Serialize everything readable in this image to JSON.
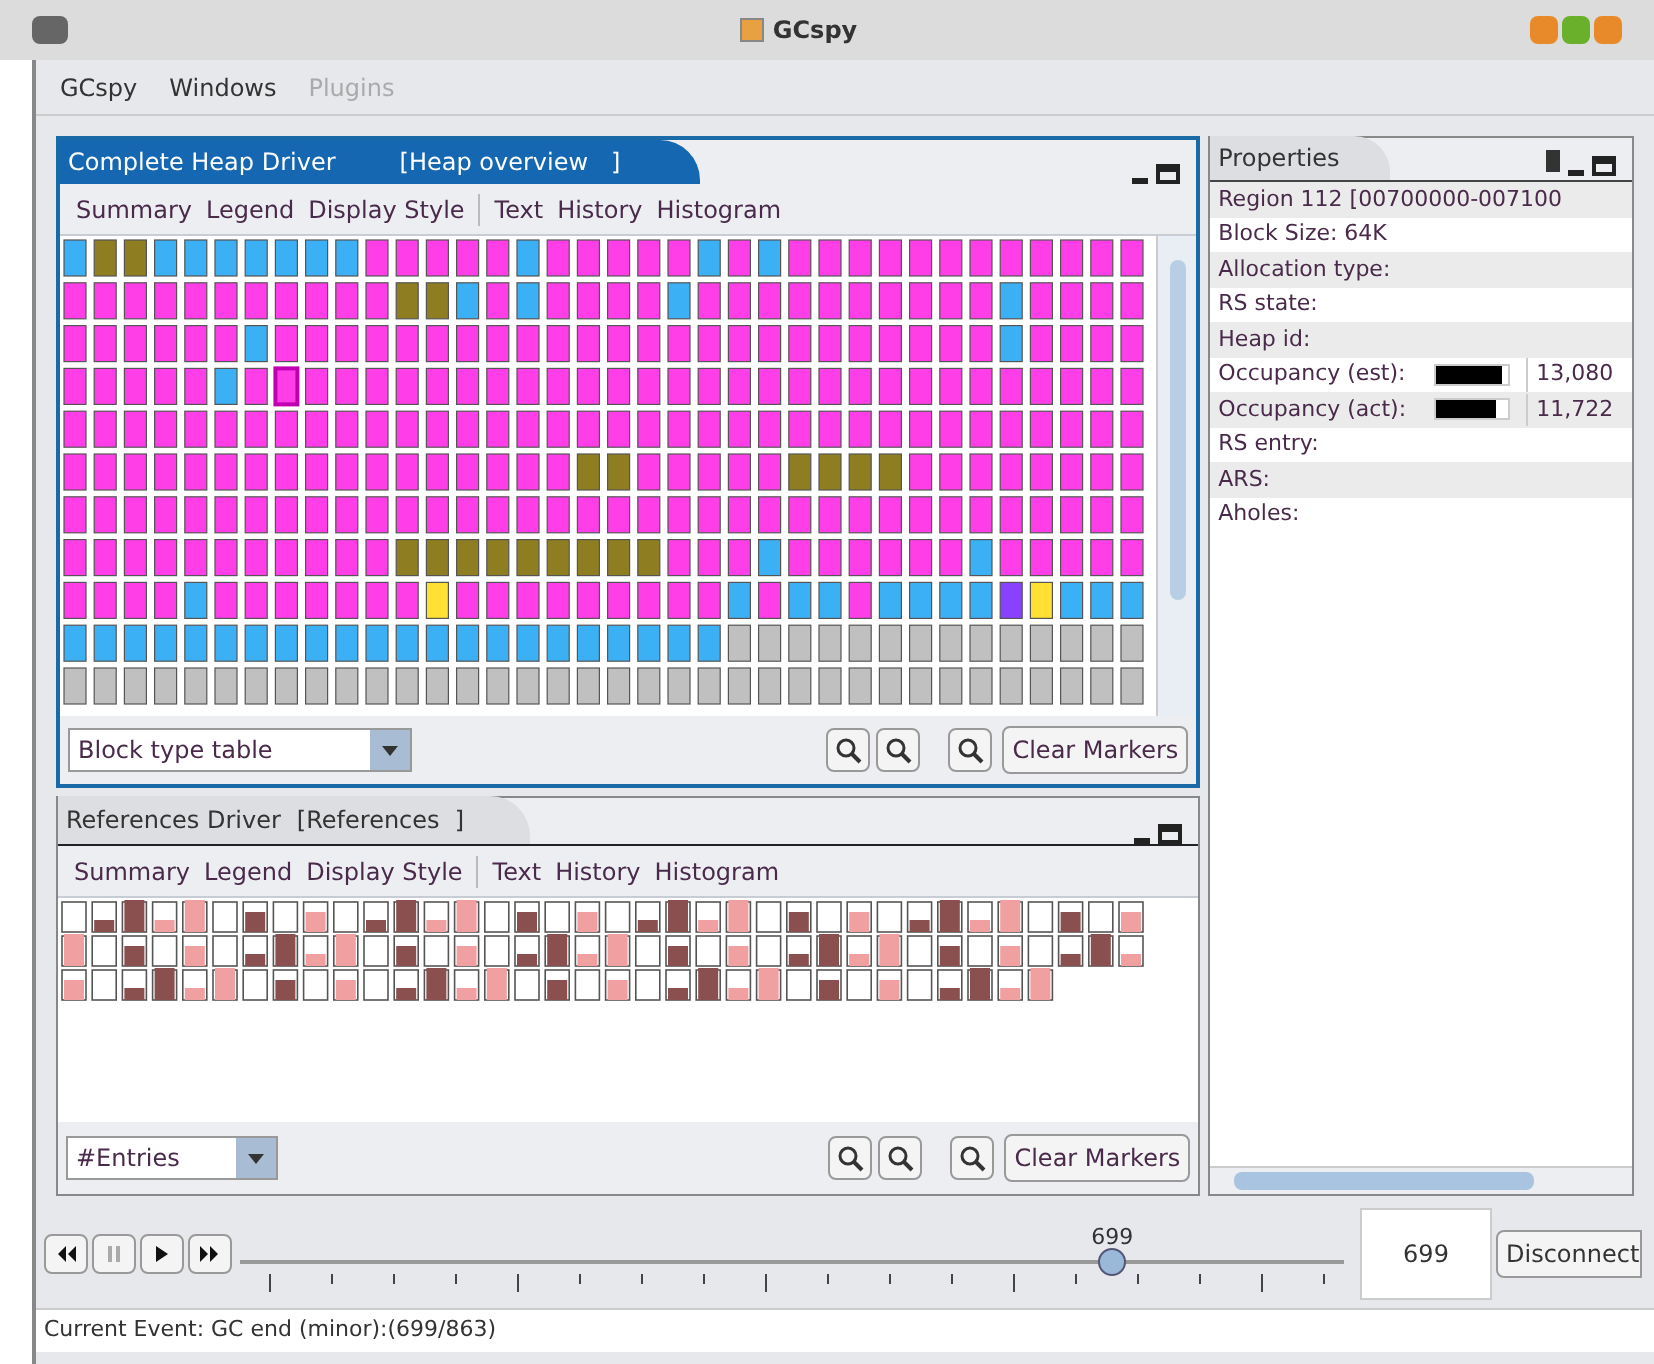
{
  "window": {
    "title": "GCspy"
  },
  "menu": [
    {
      "label": "GCspy",
      "disabled": false
    },
    {
      "label": "Windows",
      "disabled": false
    },
    {
      "label": "Plugins",
      "disabled": true
    }
  ],
  "heap_panel": {
    "tab": "Complete Heap Driver",
    "subtitle": "[Heap overview   ]",
    "toolbar": [
      "Summary",
      "Legend",
      "Display Style",
      "Text",
      "History",
      "Histogram"
    ],
    "dropdown": "Block type table",
    "button": "Clear Markers"
  },
  "references_panel": {
    "tab": "References Driver",
    "subtitle": "[References  ]",
    "toolbar": [
      "Summary",
      "Legend",
      "Display Style",
      "Text",
      "History",
      "Histogram"
    ],
    "dropdown": "#Entries",
    "button": "Clear Markers"
  },
  "properties": {
    "tab": "Properties",
    "rows": [
      {
        "kind": "text",
        "label": "Region 112   [00700000-007100"
      },
      {
        "kind": "text",
        "label": "Block Size: 64K"
      },
      {
        "kind": "text",
        "label": "Allocation type:"
      },
      {
        "kind": "text",
        "label": "RS state:"
      },
      {
        "kind": "text",
        "label": "Heap id:"
      },
      {
        "kind": "bar",
        "label": "Occupancy (est):",
        "level": 0.92,
        "value": "13,080"
      },
      {
        "kind": "bar",
        "label": "Occupancy (act):",
        "level": 0.82,
        "value": "11,722"
      },
      {
        "kind": "text",
        "label": "RS entry:"
      },
      {
        "kind": "text",
        "label": "ARS:"
      },
      {
        "kind": "text",
        "label": "Aholes:"
      }
    ]
  },
  "player": {
    "slider_value": "699",
    "level": 0.79,
    "field": "699",
    "button": "Disconnect"
  },
  "status_bar": "Current Event: GC end (minor):(699/863)"
}
